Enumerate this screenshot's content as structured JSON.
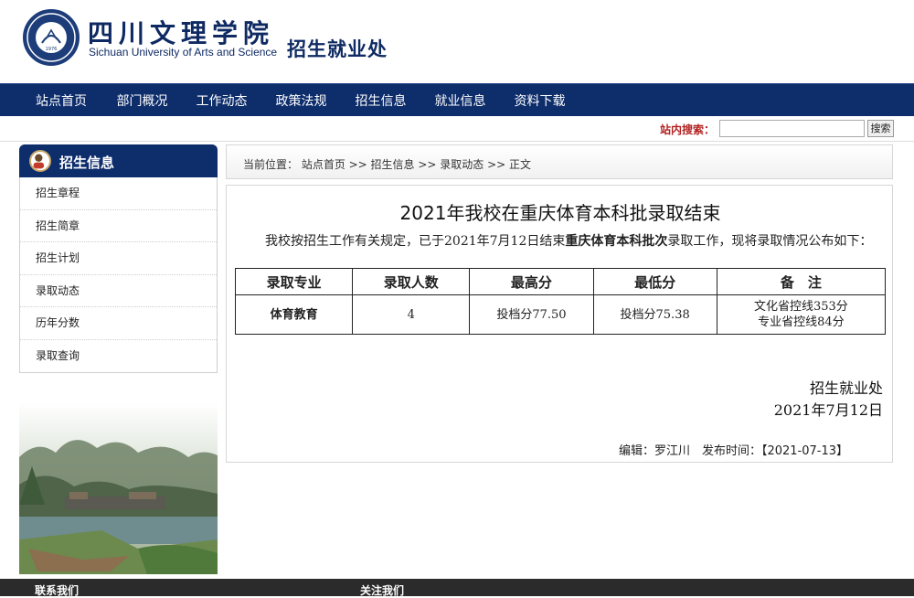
{
  "header": {
    "school_cn": "四川文理学院",
    "school_en": "Sichuan University of Arts and Science",
    "dept": "招生就业处",
    "seal_year": "1976"
  },
  "nav": {
    "items": [
      "站点首页",
      "部门概况",
      "工作动态",
      "政策法规",
      "招生信息",
      "就业信息",
      "资料下载"
    ]
  },
  "search": {
    "label": "站内搜索：",
    "value": "",
    "button": "搜索"
  },
  "sidebar": {
    "title": "招生信息",
    "items": [
      "招生章程",
      "招生简章",
      "招生计划",
      "录取动态",
      "历年分数",
      "录取查询"
    ]
  },
  "breadcrumb": "当前位置： 站点首页 >> 招生信息 >> 录取动态 >> 正文",
  "article": {
    "title": "2021年我校在重庆体育本科批录取结束",
    "para_before": "我校按招生工作有关规定，已于2021年7月12日结束",
    "para_bold": "重庆体育本科批次",
    "para_after": "录取工作，现将录取情况公布如下：",
    "table": {
      "headers": [
        "录取专业",
        "录取人数",
        "最高分",
        "最低分",
        "备　注"
      ],
      "rows": [
        {
          "major": "体育教育",
          "count": "4",
          "max": "投档分77.50",
          "min": "投档分75.38",
          "note1": "文化省控线353分",
          "note2": "专业省控线84分"
        }
      ]
    },
    "sign_dept": "招生就业处",
    "sign_date": "2021年7月12日",
    "meta": "编辑：罗江川　发布时间：【2021-07-13】"
  },
  "footer": {
    "contact": "联系我们",
    "follow": "关注我们"
  },
  "colors": {
    "nav_bg": "#0d2d6b",
    "brand": "#0f2a63",
    "search_label": "#b22222",
    "footer_bg": "#2b2b2b"
  }
}
